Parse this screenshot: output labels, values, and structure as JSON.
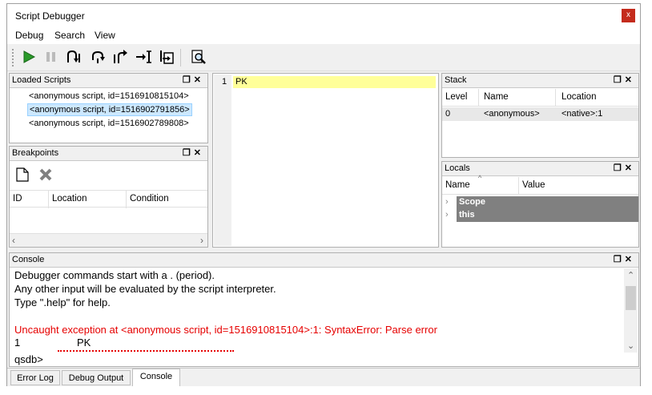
{
  "window": {
    "title": "Script Debugger",
    "close_label": "x"
  },
  "menu": [
    "Debug",
    "Search",
    "View"
  ],
  "toolbar": {
    "buttons": [
      "play-icon",
      "pause-icon",
      "step-into-icon",
      "step-over-icon",
      "step-out-icon",
      "run-to-cursor-icon",
      "run-to-new-script-icon",
      "find-icon"
    ]
  },
  "loaded_scripts": {
    "title": "Loaded Scripts",
    "items": [
      "<anonymous script, id=1516910815104>",
      "<anonymous script, id=1516902791856>",
      "<anonymous script, id=1516902789808>"
    ],
    "selected_index": 1
  },
  "breakpoints": {
    "title": "Breakpoints",
    "columns": [
      "ID",
      "Location",
      "Condition"
    ]
  },
  "editor": {
    "line_number": "1",
    "code": "PK"
  },
  "stack": {
    "title": "Stack",
    "columns": [
      "Level",
      "Name",
      "Location"
    ],
    "rows": [
      {
        "level": "0",
        "name": "<anonymous>",
        "location": "<native>:1"
      }
    ]
  },
  "locals": {
    "title": "Locals",
    "columns": [
      "Name",
      "Value"
    ],
    "rows": [
      "Scope",
      "this"
    ]
  },
  "console": {
    "title": "Console",
    "lines": [
      {
        "text": "Debugger commands start with a . (period).",
        "color": "#000000"
      },
      {
        "text": "Any other input will be evaluated by the script interpreter.",
        "color": "#000000"
      },
      {
        "text": "Type \".help\" for help.",
        "color": "#000000"
      },
      {
        "text": "",
        "color": "#000000"
      },
      {
        "text": "Uncaught exception at <anonymous script, id=1516910815104>:1: SyntaxError: Parse error",
        "color": "#e60000"
      }
    ],
    "source_line_number": "1",
    "source_line_code": "PK",
    "prompt": "qsdb>"
  },
  "tabs": [
    "Error Log",
    "Debug Output",
    "Console"
  ],
  "active_tab": "Console",
  "colors": {
    "error_red": "#e60000",
    "selection": "#cce8ff",
    "editor_highlight": "#ffff99",
    "locals_row": "#808080",
    "close_red": "#c42b1c"
  }
}
